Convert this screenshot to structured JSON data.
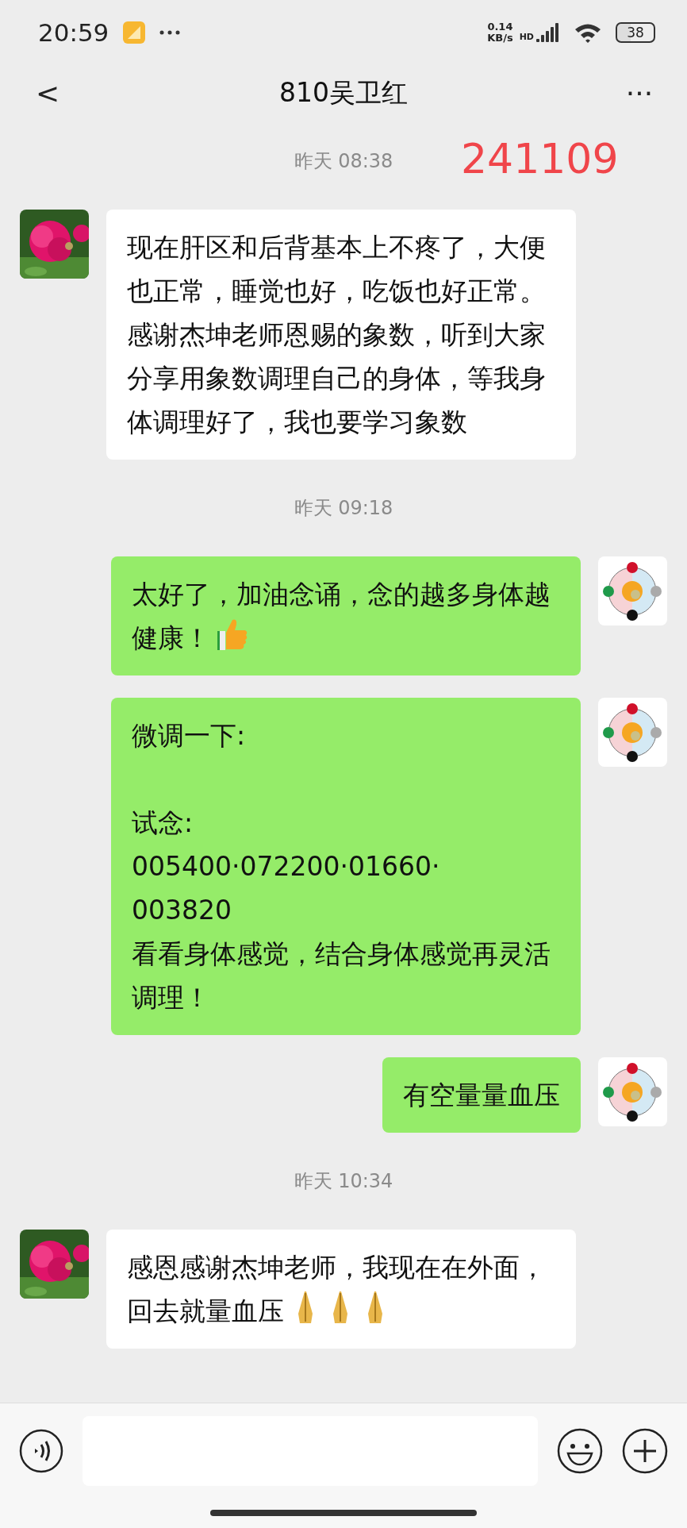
{
  "status_bar": {
    "time": "20:59",
    "network_speed": "0.14",
    "network_unit": "KB/s",
    "network_type": "HD",
    "battery": "38"
  },
  "header": {
    "back": "<",
    "title": "810吴卫红",
    "more": "···"
  },
  "annotation": "241109",
  "messages": [
    {
      "kind": "time",
      "text": "昨天 08:38"
    },
    {
      "kind": "incoming",
      "text": "现在肝区和后背基本上不疼了，大便也正常，睡觉也好，吃饭也好正常。感谢杰坤老师恩赐的象数，听到大家分享用象数调理自己的身体，等我身体调理好了，我也要学习象数"
    },
    {
      "kind": "time",
      "text": "昨天 09:18"
    },
    {
      "kind": "outgoing",
      "text": "太好了，加油念诵，念的越多身体越健康！",
      "trailing_icons": [
        {
          "kind": "thumbs_up"
        }
      ]
    },
    {
      "kind": "outgoing",
      "text": "微调一下:\n\n试念:\n005400·072200·01660·\n003820\n看看身体感觉，结合身体感觉再灵活调理！"
    },
    {
      "kind": "outgoing",
      "text": "有空量量血压"
    },
    {
      "kind": "time",
      "text": "昨天 10:34"
    },
    {
      "kind": "incoming",
      "text": "感恩感谢杰坤老师，我现在在外面，回去就量血压",
      "trailing_icons": [
        {
          "kind": "praying_hands"
        },
        {
          "kind": "praying_hands"
        },
        {
          "kind": "praying_hands"
        }
      ]
    }
  ]
}
